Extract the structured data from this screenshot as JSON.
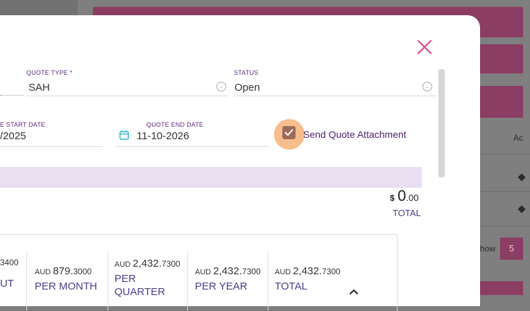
{
  "background": {
    "action_header_fragment": "Ac",
    "show_label_fragment": "how",
    "page_size": "5"
  },
  "modal": {
    "quote_type": {
      "label": "QUOTE TYPE",
      "required_mark": "*",
      "value": "SAH"
    },
    "status": {
      "label": "STATUS",
      "value": "Open"
    },
    "start_date": {
      "label_fragment": "E START DATE",
      "value_fragment": "/2025"
    },
    "end_date": {
      "label": "QUOTE END DATE",
      "value": "11-10-2026"
    },
    "send_attachment": {
      "label": "Send Quote Attachment",
      "checked": true
    },
    "total": {
      "currency_symbol": "$",
      "amount_whole": "0",
      "amount_decimal": ".00",
      "label": "TOTAL"
    },
    "summary": {
      "partial": {
        "value_fragment": "3400",
        "label_fragment": "UT"
      },
      "columns": [
        {
          "currency": "AUD",
          "value": "879.",
          "value_tail": "3000",
          "label": "PER MONTH"
        },
        {
          "currency": "AUD",
          "value": "2,432.",
          "value_tail": "7300",
          "label": "PER QUARTER"
        },
        {
          "currency": "AUD",
          "value": "2,432.",
          "value_tail": "7300",
          "label": "PER YEAR"
        },
        {
          "currency": "AUD",
          "value": "2,432.",
          "value_tail": "7300",
          "label": "TOTAL"
        }
      ]
    }
  },
  "colors": {
    "accent_pink": "#d6488a",
    "label_purple": "#5c2a7d",
    "link_blue": "#4a3b8a",
    "band": "#e8dff0",
    "checkbox": "#9c6b5a",
    "halo": "#f6b279",
    "bg_bar": "#8b3d63"
  },
  "icons": {
    "close": "close-icon",
    "dropdown": "chevron-down-circle-icon",
    "calendar": "calendar-icon",
    "checkbox": "checkbox-checked-icon",
    "collapse": "chevron-up-icon"
  }
}
